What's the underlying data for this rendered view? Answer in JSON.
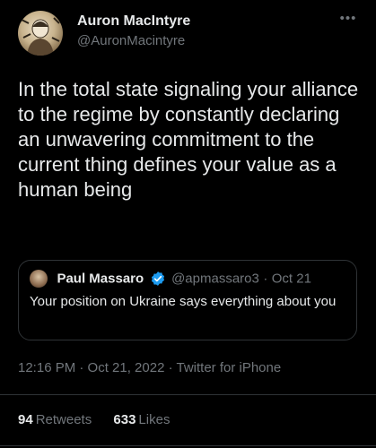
{
  "author": {
    "display_name": "Auron MacIntyre",
    "handle": "@AuronMacintyre",
    "avatar_icon": "profile-avatar"
  },
  "more_icon": "more-dots-icon",
  "tweet_text": "In the total state signaling your alliance to the regime by constantly declaring an unwavering commitment to the current thing defines your value as a human being",
  "quote": {
    "author_name": "Paul Massaro",
    "verified": true,
    "verified_icon": "verified-badge-icon",
    "handle": "@apmassaro3",
    "separator": "·",
    "date": "Oct 21",
    "text": "Your position on Ukraine says everything about you"
  },
  "meta": "12:16 PM · Oct 21, 2022 · Twitter for iPhone",
  "stats": {
    "retweets": "94",
    "retweets_label": "Retweets",
    "likes": "633",
    "likes_label": "Likes"
  },
  "colors": {
    "background": "#000000",
    "text": "#e7e9ea",
    "secondary": "#71767b",
    "verified": "#1d9bf0",
    "border": "#2f3336"
  }
}
